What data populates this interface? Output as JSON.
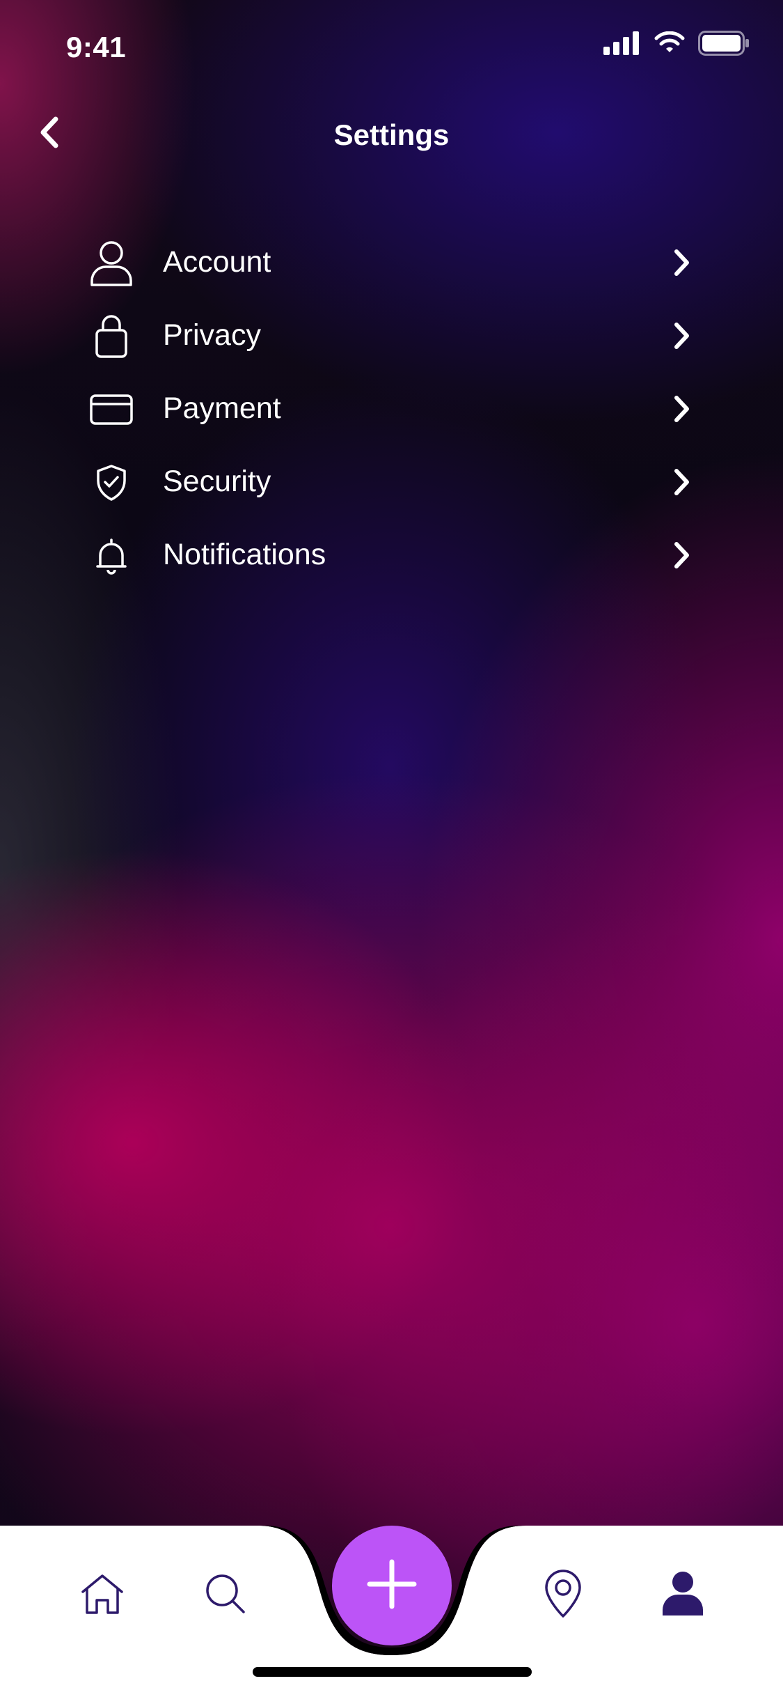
{
  "status_bar": {
    "time": "9:41"
  },
  "header": {
    "title": "Settings",
    "back_icon": "chevron-left-icon"
  },
  "settings": {
    "items": [
      {
        "label": "Account",
        "icon": "user-icon"
      },
      {
        "label": "Privacy",
        "icon": "lock-icon"
      },
      {
        "label": "Payment",
        "icon": "credit-card-icon"
      },
      {
        "label": "Security",
        "icon": "shield-check-icon"
      },
      {
        "label": "Notifications",
        "icon": "bell-icon"
      }
    ]
  },
  "tab_bar": {
    "tabs": [
      {
        "icon": "home-icon"
      },
      {
        "icon": "search-icon"
      },
      {
        "icon": "plus-icon"
      },
      {
        "icon": "location-pin-icon"
      },
      {
        "icon": "profile-icon"
      }
    ]
  },
  "colors": {
    "accent": "#bc54f7",
    "tab_icon": "#2d1a6b",
    "tab_bar_bg": "#ffffff"
  }
}
